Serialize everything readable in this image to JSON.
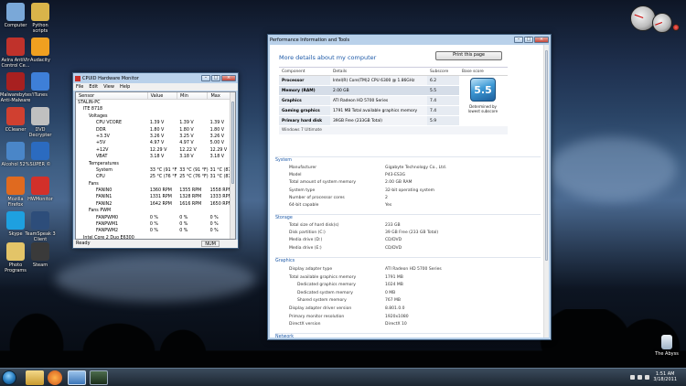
{
  "desktop": {
    "icons": [
      {
        "label": "Computer",
        "color": "#7aa8d8"
      },
      {
        "label": "Python scripts",
        "color": "#d9b44a"
      },
      {
        "label": "Avira AntiVir Control Ce...",
        "color": "#c0322b"
      },
      {
        "label": "Audacity",
        "color": "#f0a020"
      },
      {
        "label": "Malwarebytes' Anti-Malware",
        "color": "#a82020"
      },
      {
        "label": "iTunes",
        "color": "#3e7fd8"
      },
      {
        "label": "CCleaner",
        "color": "#d04030"
      },
      {
        "label": "DVD Decrypter",
        "color": "#c0c0c0"
      },
      {
        "label": "Alcohol 52%",
        "color": "#4a86c8"
      },
      {
        "label": "SUPER ©",
        "color": "#2b6bc0"
      },
      {
        "label": "Mozilla Firefox",
        "color": "#e06a1f"
      },
      {
        "label": "HWMonitor",
        "color": "#d2302a"
      },
      {
        "label": "Skype",
        "color": "#1ea0e0"
      },
      {
        "label": "TeamSpeak 3 Client",
        "color": "#2d4d7a"
      },
      {
        "label": "Photo Programs",
        "color": "#e3c468"
      },
      {
        "label": "Steam",
        "color": "#3a3a3a"
      }
    ],
    "recycle_bin": "The Abyss"
  },
  "hwmonitor": {
    "title": "CPUID Hardware Monitor",
    "menu": [
      "File",
      "Edit",
      "View",
      "Help"
    ],
    "columns": [
      "Sensor",
      "Value",
      "Min",
      "Max"
    ],
    "rows": [
      {
        "name": "STALIN-PC",
        "value": "",
        "min": "",
        "max": ""
      },
      {
        "name": "ITE 8718",
        "value": "",
        "min": "",
        "max": ""
      },
      {
        "name": "Voltages",
        "value": "",
        "min": "",
        "max": ""
      },
      {
        "name": "CPU VCORE",
        "value": "1.39 V",
        "min": "1.39 V",
        "max": "1.39 V"
      },
      {
        "name": "DDR",
        "value": "1.80 V",
        "min": "1.80 V",
        "max": "1.80 V"
      },
      {
        "name": "+3.3V",
        "value": "3.26 V",
        "min": "3.25 V",
        "max": "3.26 V"
      },
      {
        "name": "+5V",
        "value": "4.97 V",
        "min": "4.97 V",
        "max": "5.00 V"
      },
      {
        "name": "+12V",
        "value": "12.29 V",
        "min": "12.22 V",
        "max": "12.29 V"
      },
      {
        "name": "VBAT",
        "value": "3.18 V",
        "min": "3.18 V",
        "max": "3.18 V"
      },
      {
        "name": "Temperatures",
        "value": "",
        "min": "",
        "max": ""
      },
      {
        "name": "System",
        "value": "33 °C (91 °F)",
        "min": "33 °C (91 °F)",
        "max": "31 °C (87 °F)"
      },
      {
        "name": "CPU",
        "value": "25 °C (76 °F)",
        "min": "25 °C (76 °F)",
        "max": "31 °C (87 °F)"
      },
      {
        "name": "Fans",
        "value": "",
        "min": "",
        "max": ""
      },
      {
        "name": "FANIN0",
        "value": "1360 RPM",
        "min": "1355 RPM",
        "max": "1558 RPM"
      },
      {
        "name": "FANIN1",
        "value": "1331 RPM",
        "min": "1328 RPM",
        "max": "1333 RPM"
      },
      {
        "name": "FANIN2",
        "value": "1642 RPM",
        "min": "1616 RPM",
        "max": "1650 RPM"
      },
      {
        "name": "Fans PWM",
        "value": "",
        "min": "",
        "max": ""
      },
      {
        "name": "FANPWM0",
        "value": "0 %",
        "min": "0 %",
        "max": "0 %"
      },
      {
        "name": "FANPWM1",
        "value": "0 %",
        "min": "0 %",
        "max": "0 %"
      },
      {
        "name": "FANPWM2",
        "value": "0 %",
        "min": "0 %",
        "max": "0 %"
      },
      {
        "name": "Intel Core 2 Duo E6300",
        "value": "",
        "min": "",
        "max": ""
      }
    ],
    "status": "Ready",
    "num": "NUM"
  },
  "perf": {
    "title": "Performance Information and Tools",
    "heading": "More details about my computer",
    "print_button": "Print this page",
    "table_headers": [
      "Component",
      "Details",
      "Subscore",
      "Base score"
    ],
    "rating_rows": [
      {
        "component": "Processor",
        "details": "Intel(R) Core(TM)2 CPU 6300 @ 1.86GHz",
        "subscore": "6.2"
      },
      {
        "component": "Memory (RAM)",
        "details": "2.00 GB",
        "subscore": "5.5"
      },
      {
        "component": "Graphics",
        "details": "ATI Radeon HD 5700 Series",
        "subscore": "7.4"
      },
      {
        "component": "Gaming graphics",
        "details": "1791 MB Total available graphics memory",
        "subscore": "7.4"
      },
      {
        "component": "Primary hard disk",
        "details": "39GB Free (233GB Total)",
        "subscore": "5.9"
      }
    ],
    "os": "Windows 7 Ultimate",
    "base_score": "5.5",
    "base_caption": "Determined by lowest subscore",
    "sections": {
      "system": {
        "title": "System",
        "items": [
          [
            "Manufacturer",
            "Gigabyte Technology Co., Ltd."
          ],
          [
            "Model",
            "P43-ES3G"
          ],
          [
            "Total amount of system memory",
            "2.00 GB RAM"
          ],
          [
            "System type",
            "32-bit operating system"
          ],
          [
            "Number of processor cores",
            "2"
          ],
          [
            "64-bit capable",
            "Yes"
          ]
        ]
      },
      "storage": {
        "title": "Storage",
        "items": [
          [
            "Total size of hard disk(s)",
            "233 GB"
          ],
          [
            "Disk partition (C:)",
            "39 GB Free (233 GB Total)"
          ],
          [
            "Media drive (D:)",
            "CD/DVD"
          ],
          [
            "Media drive (E:)",
            "CD/DVD"
          ]
        ]
      },
      "graphics": {
        "title": "Graphics",
        "items": [
          [
            "Display adapter type",
            "ATI Radeon HD 5700 Series"
          ],
          [
            "Total available graphics memory",
            "1791 MB"
          ],
          [
            "Dedicated graphics memory",
            "1024 MB"
          ],
          [
            "Dedicated system memory",
            "0 MB"
          ],
          [
            "Shared system memory",
            "767 MB"
          ],
          [
            "Display adapter driver version",
            "8.801.0.0"
          ],
          [
            "Primary monitor resolution",
            "1920x1080"
          ],
          [
            "DirectX version",
            "DirectX 10"
          ]
        ]
      },
      "network": {
        "title": "Network"
      }
    }
  },
  "taskbar": {
    "time": "1:51 AM",
    "date": "3/18/2011"
  }
}
